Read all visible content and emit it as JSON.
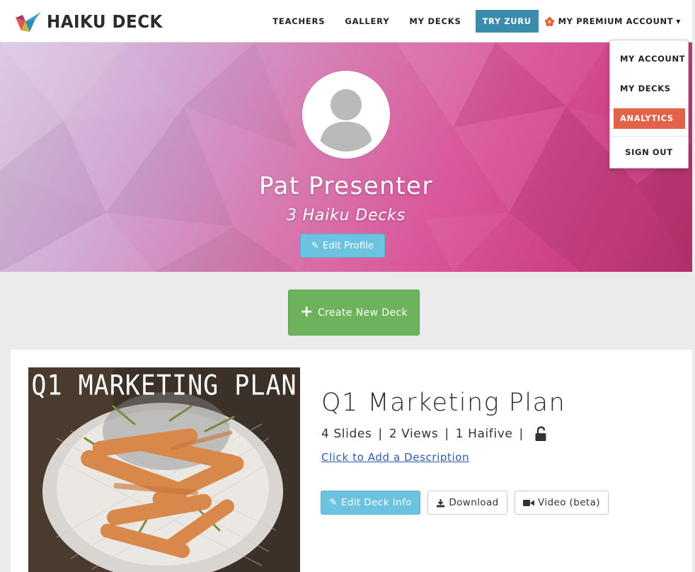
{
  "brand": {
    "name": "HAIKU DECK"
  },
  "nav": {
    "links": [
      "TEACHERS",
      "GALLERY",
      "MY DECKS"
    ],
    "try_button": "TRY ZURU",
    "account_label": "MY PREMIUM ACCOUNT"
  },
  "account_menu": {
    "items": [
      "MY ACCOUNT",
      "MY DECKS",
      "ANALYTICS",
      "SIGN OUT"
    ],
    "active": "ANALYTICS"
  },
  "profile": {
    "name": "Pat Presenter",
    "deck_count": "3 Haiku Decks",
    "edit_button": "Edit Profile"
  },
  "create_button": "Create New Deck",
  "deck": {
    "thumbnail_title": "Q1 MARKETING PLAN",
    "title": "Q1 Marketing Plan",
    "slides": "4 Slides",
    "views": "2 Views",
    "haifives": "1 Haifive",
    "description_link": "Click to Add a Description",
    "buttons": {
      "edit": "Edit Deck Info",
      "download": "Download",
      "video": "Video (beta)"
    }
  },
  "colors": {
    "nav_button": "#3b8bab",
    "analytics_highlight": "#e2624a",
    "info_button": "#6cc3df",
    "create_button": "#6db35c",
    "link": "#2a5db0"
  },
  "icons": [
    "haiku-deck-logo-icon",
    "flower-icon",
    "caret-down-icon",
    "avatar-icon",
    "edit-icon",
    "plus-icon",
    "unlock-icon",
    "download-icon",
    "video-icon"
  ]
}
